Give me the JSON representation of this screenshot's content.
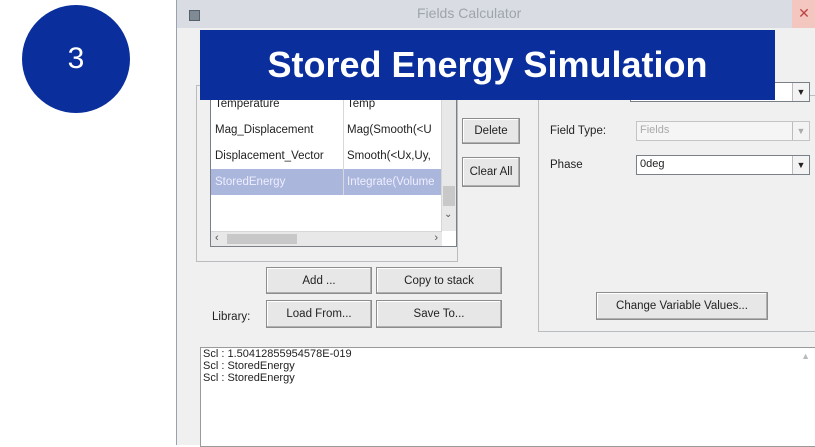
{
  "step": {
    "number": "3"
  },
  "banner": {
    "title": "Stored Energy Simulation"
  },
  "window": {
    "title": "Fields Calculator"
  },
  "fields_list": {
    "rows": [
      {
        "name": "Temperature",
        "expr": "Temp"
      },
      {
        "name": "Mag_Displacement",
        "expr": "Mag(Smooth(<U"
      },
      {
        "name": "Displacement_Vector",
        "expr": "Smooth(<Ux,Uy,"
      },
      {
        "name": "StoredEnergy",
        "expr": "Integrate(Volume"
      }
    ],
    "selected_index": 3
  },
  "buttons": {
    "delete": "Delete",
    "clear_all": "Clear All",
    "add": "Add ...",
    "copy_to_stack": "Copy to stack",
    "load_from": "Load From...",
    "save_to": "Save To...",
    "change_variable_values": "Change Variable Values..."
  },
  "library_label": "Library:",
  "field_type": {
    "label": "Field Type:",
    "value": "Fields"
  },
  "phase": {
    "label": "Phase",
    "value": "0deg"
  },
  "output": {
    "lines": [
      "Scl : 1.50412855954578E-019",
      "Scl : StoredEnergy",
      "Scl : StoredEnergy"
    ]
  },
  "colors": {
    "accent": "#0a2f9c",
    "selection": "#aab6dc"
  },
  "icons": {
    "close": "close-icon",
    "system": "window-menu-icon"
  }
}
